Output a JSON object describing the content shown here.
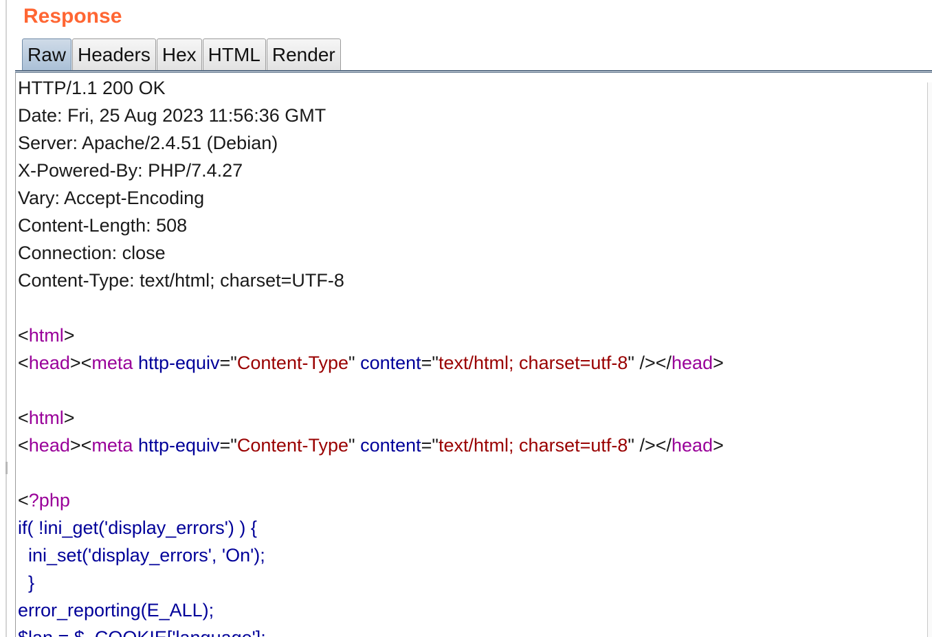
{
  "panel": {
    "title": "Response"
  },
  "tabs": [
    {
      "label": "Raw",
      "active": true
    },
    {
      "label": "Headers",
      "active": false
    },
    {
      "label": "Hex",
      "active": false
    },
    {
      "label": "HTML",
      "active": false
    },
    {
      "label": "Render",
      "active": false
    }
  ],
  "colors": {
    "title": "#ff6633",
    "tag": "#990099",
    "attribute": "#000099",
    "value": "#990000",
    "php": "#000099",
    "text": "#1a1a1a",
    "active_tab": "#a9bfd6"
  },
  "response": {
    "headers": [
      "HTTP/1.1 200 OK",
      "Date: Fri, 25 Aug 2023 11:56:36 GMT",
      "Server: Apache/2.4.51 (Debian)",
      "X-Powered-By: PHP/7.4.27",
      "Vary: Accept-Encoding",
      "Content-Length: 508",
      "Connection: close",
      "Content-Type: text/html; charset=UTF-8"
    ],
    "body": [
      [],
      [
        [
          "plain",
          "<"
        ],
        [
          "tag",
          "html"
        ],
        [
          "plain",
          ">"
        ]
      ],
      [
        [
          "plain",
          "<"
        ],
        [
          "tag",
          "head"
        ],
        [
          "plain",
          "><"
        ],
        [
          "tag",
          "meta"
        ],
        [
          "plain",
          " "
        ],
        [
          "attr",
          "http-equiv"
        ],
        [
          "plain",
          "=\""
        ],
        [
          "val",
          "Content-Type"
        ],
        [
          "plain",
          "\" "
        ],
        [
          "attr",
          "content"
        ],
        [
          "plain",
          "=\""
        ],
        [
          "val",
          "text/html; charset=utf-8"
        ],
        [
          "plain",
          "\" /></"
        ],
        [
          "tag",
          "head"
        ],
        [
          "plain",
          ">"
        ]
      ],
      [],
      [
        [
          "plain",
          "<"
        ],
        [
          "tag",
          "html"
        ],
        [
          "plain",
          ">"
        ]
      ],
      [
        [
          "plain",
          "<"
        ],
        [
          "tag",
          "head"
        ],
        [
          "plain",
          "><"
        ],
        [
          "tag",
          "meta"
        ],
        [
          "plain",
          " "
        ],
        [
          "attr",
          "http-equiv"
        ],
        [
          "plain",
          "=\""
        ],
        [
          "val",
          "Content-Type"
        ],
        [
          "plain",
          "\" "
        ],
        [
          "attr",
          "content"
        ],
        [
          "plain",
          "=\""
        ],
        [
          "val",
          "text/html; charset=utf-8"
        ],
        [
          "plain",
          "\" /></"
        ],
        [
          "tag",
          "head"
        ],
        [
          "plain",
          ">"
        ]
      ],
      [],
      [
        [
          "plain",
          "<"
        ],
        [
          "tag",
          "?php"
        ]
      ],
      [
        [
          "php",
          "if( !ini_get('display_errors') ) {"
        ]
      ],
      [
        [
          "php",
          "  ini_set('display_errors', 'On');"
        ]
      ],
      [
        [
          "php",
          "  }"
        ]
      ],
      [
        [
          "php",
          "error_reporting(E_ALL);"
        ]
      ],
      [
        [
          "php",
          "$lan = $_COOKIE['language'];"
        ]
      ]
    ]
  }
}
